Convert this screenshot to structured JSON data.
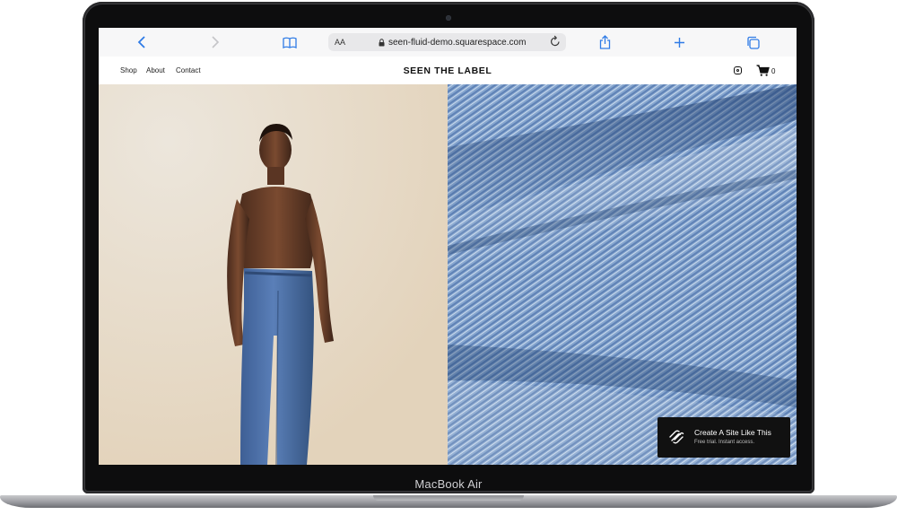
{
  "device": {
    "label": "MacBook Air"
  },
  "browser": {
    "text_size_label": "AA",
    "url": "seen-fluid-demo.squarespace.com"
  },
  "site": {
    "nav": [
      "Shop",
      "About",
      "Contact"
    ],
    "brand": "SEEN THE LABEL",
    "cart_count": "0"
  },
  "cta": {
    "title": "Create A Site Like This",
    "subtitle": "Free trial. Instant access."
  },
  "colors": {
    "accent": "#2f7be6",
    "backdrop": "#e9ddca",
    "denim": "#7d9ec7",
    "cta_bg": "#111111"
  }
}
